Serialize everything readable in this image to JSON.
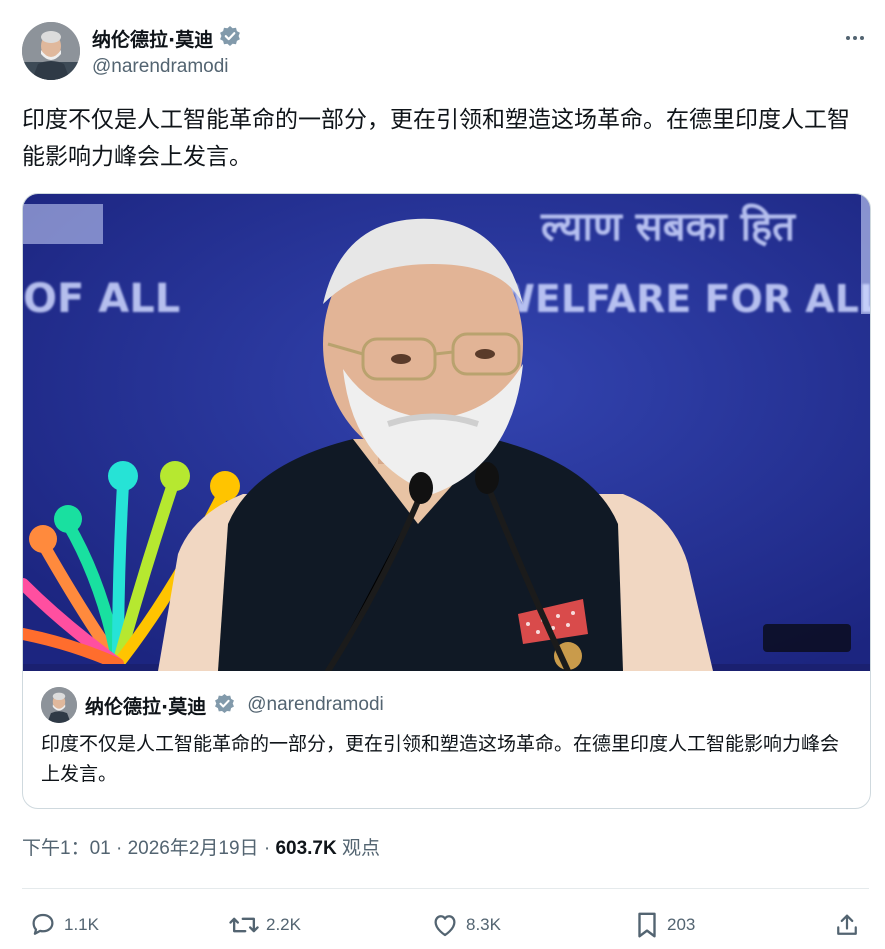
{
  "author": {
    "name": "纳伦德拉·莫迪",
    "handle": "@narendramodi"
  },
  "tweet": {
    "text": "印度不仅是人工智能革命的一部分，更在引领和塑造这场革命。在德里印度人工智能影响力峰会上发言。"
  },
  "media": {
    "backdrop_text_top": "ल्याण सबका हित",
    "backdrop_text_left": "OF ALL",
    "backdrop_text_right": "WELFARE FOR ALL"
  },
  "quote": {
    "name": "纳伦德拉·莫迪",
    "handle": "@narendramodi",
    "text": "印度不仅是人工智能革命的一部分，更在引领和塑造这场革命。在德里印度人工智能影响力峰会上发言。"
  },
  "meta": {
    "time": "下午1：01",
    "separator": " · ",
    "date": "2026年2月19日",
    "views_count": "603.7K",
    "views_label": "观点"
  },
  "actions": {
    "replies": "1.1K",
    "reposts": "2.2K",
    "likes": "8.3K",
    "bookmarks": "203"
  },
  "colors": {
    "verified": "#829aab",
    "secondary_text": "#536471",
    "backdrop": "#1f2a8a"
  },
  "icons": [
    "more-icon",
    "verified-icon",
    "reply-icon",
    "repost-icon",
    "like-icon",
    "bookmark-icon",
    "share-icon"
  ]
}
